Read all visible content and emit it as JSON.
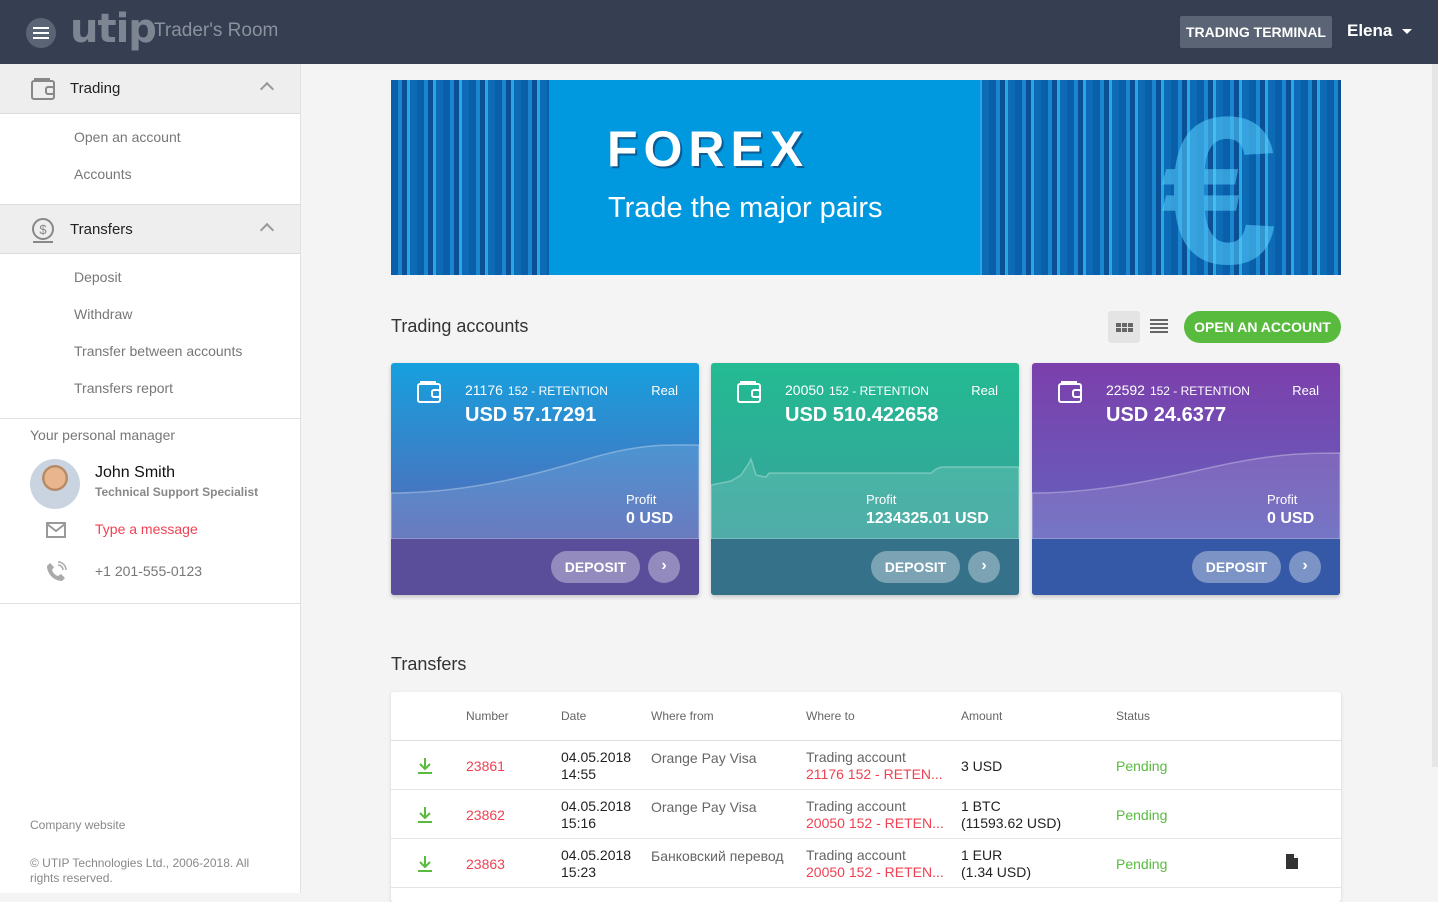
{
  "header": {
    "logo": "utip",
    "app_name": "Trader's Room",
    "terminal_button": "TRADING TERMINAL",
    "user_name": "Elena"
  },
  "sidebar": {
    "sections": [
      {
        "label": "Trading",
        "icon": "wallet-icon",
        "items": [
          "Open an account",
          "Accounts"
        ]
      },
      {
        "label": "Transfers",
        "icon": "dollar-coin-icon",
        "items": [
          "Deposit",
          "Withdraw",
          "Transfer between accounts",
          "Transfers report"
        ]
      }
    ],
    "manager": {
      "title": "Your personal manager",
      "name": "John Smith",
      "role": "Technical Support Specialist",
      "message_link": "Type a message",
      "phone": "+1 201-555-0123"
    },
    "company_link": "Company website",
    "copyright": "© UTIP Technologies Ltd., 2006-2018. All rights reserved."
  },
  "banner": {
    "title": "FOREX",
    "subtitle": "Trade the major pairs"
  },
  "accounts": {
    "title": "Trading accounts",
    "open_button": "OPEN AN ACCOUNT",
    "view_modes": [
      "grid-view-icon",
      "list-view-icon"
    ],
    "cards": [
      {
        "number": "21176",
        "group": "152 - RETENTION",
        "type": "Real",
        "balance": "USD 57.17291",
        "profit_label": "Profit",
        "profit": "0 USD",
        "deposit": "DEPOSIT",
        "colors": {
          "top": "#16a0de",
          "bottom": "#6b56aa",
          "footer": "#5a4e9a"
        }
      },
      {
        "number": "20050",
        "group": "152 - RETENTION",
        "type": "Real",
        "balance": "USD 510.422658",
        "profit_label": "Profit",
        "profit": "1234325.01 USD",
        "deposit": "DEPOSIT",
        "colors": {
          "top": "#23bb92",
          "bottom": "#3f98a0",
          "footer": "#35728a"
        }
      },
      {
        "number": "22592",
        "group": "152 - RETENTION",
        "type": "Real",
        "balance": "USD 24.6377",
        "profit_label": "Profit",
        "profit": "0 USD",
        "deposit": "DEPOSIT",
        "colors": {
          "top": "#7c3fac",
          "bottom": "#5b6ec2",
          "footer": "#3559a6"
        }
      }
    ]
  },
  "transfers": {
    "title": "Transfers",
    "columns": [
      "Number",
      "Date",
      "Where from",
      "Where to",
      "Amount",
      "Status"
    ],
    "rows": [
      {
        "number": "23861",
        "date": "04.05.2018",
        "time": "14:55",
        "from": "Orange Pay Visa",
        "to_label": "Trading account",
        "to_account": "21176 152 - RETEN...",
        "amount": "3 USD",
        "amount_usd": "",
        "status": "Pending",
        "has_file": false
      },
      {
        "number": "23862",
        "date": "04.05.2018",
        "time": "15:16",
        "from": "Orange Pay Visa",
        "to_label": "Trading account",
        "to_account": "20050 152 - RETEN...",
        "amount": "1 BTC",
        "amount_usd": "(11593.62 USD)",
        "status": "Pending",
        "has_file": false
      },
      {
        "number": "23863",
        "date": "04.05.2018",
        "time": "15:23",
        "from": "Банковский перевод",
        "to_label": "Trading account",
        "to_account": "20050 152 - RETEN...",
        "amount": "1 EUR",
        "amount_usd": "(1.34 USD)",
        "status": "Pending",
        "has_file": true
      }
    ]
  }
}
